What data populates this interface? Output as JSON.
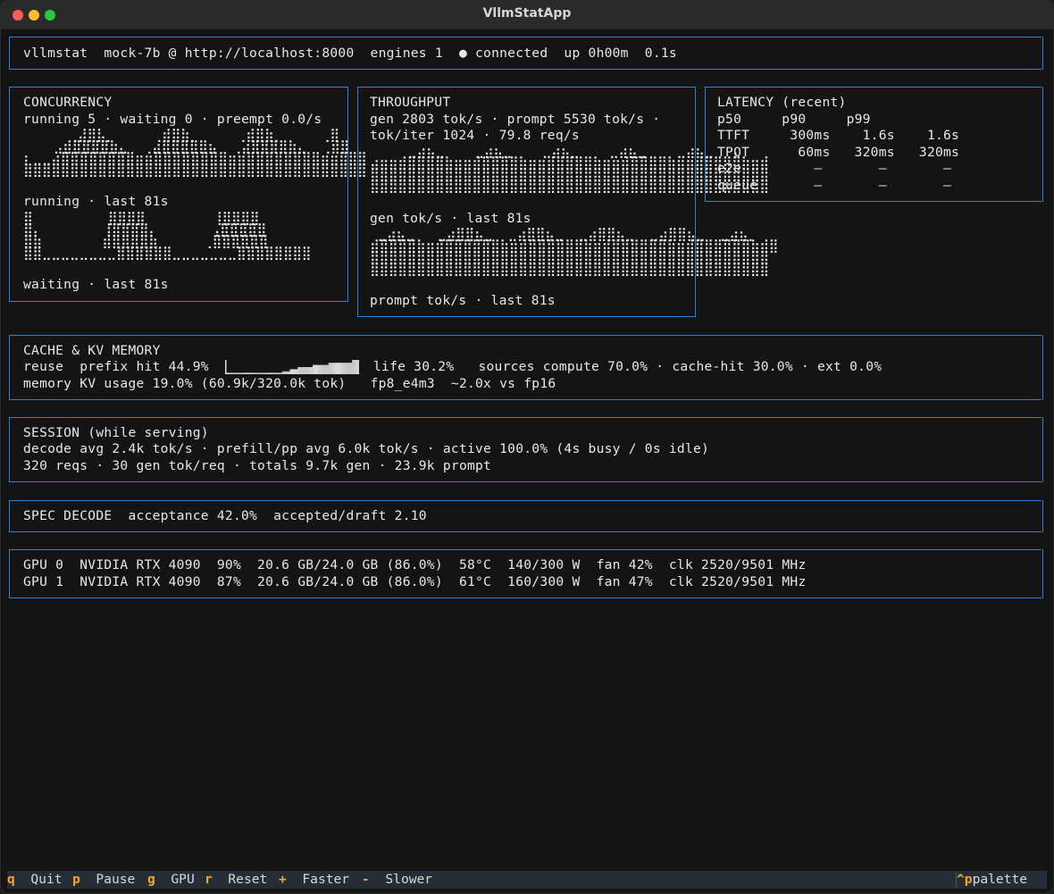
{
  "window": {
    "title": "VllmStatApp"
  },
  "header": {
    "line": "vllmstat  mock-7b @ http://localhost:8000  engines 1  ● connected  up 0h00m  0.1s"
  },
  "concurrency": {
    "title": "CONCURRENCY",
    "summary": "running 5 · waiting 0 · preempt 0.0/s",
    "running_label": "running · last 81s",
    "waiting_label": "waiting · last 81s",
    "running_graph": [
      "      ⢀⣼⣿⣧⡀     ⢀⣾⣿⣷⡀     ⢀⣾⣿⣷⡀     ⢀⣿",
      "    ⣠⣾⣿⣿⣿⣿⣷⣄  ⢀⣴⣿⣿⣿⣿⣿⣦  ⢀⣴⣿⣿⣿⣿⣷⣄  ⢀⣾⣿",
      "⡆⣀⣀⣴⣿⣿⣿⣿⣿⣿⣿⣿⣶⣶⣿⣿⣿⣿⣿⣿⣿⣿⣶⣶⣿⣿⣿⣿⣿⣿⣿⣿⣶⣶⣿⣿⣿",
      "⣿⣿⣿⣿⣿⣿⣿⣿⣿⣿⣿⣿⣿⣿⣿⣿⣿⣿⣿⣿⣿⣿⣿⣿⣿⣿⣿⣿⣿⣿⣿⣿⣿⣿⣿⣿⣿"
    ],
    "waiting_graph": [
      "⣿          ⣿⣿⣿⣿         ⢸⣿⣿⣿⣿",
      "⣿⡄        ⢸⣿⣿⣿⣿⡄       ⢠⣿⣿⣿⣿⣿",
      "⣿⣷        ⣾⣿⣿⣿⣿⣷      ⢀⣿⣿⣿⣿⣿⣿",
      "⣿⣿⣀⣀⣀⣀⣀⣀⣀⣀⣿⣿⣿⣿⣿⣿⣀⣀⣀⣀⣀⣀⣀⣿⣿⣿⣿⣿⣿⣿⣿"
    ]
  },
  "throughput": {
    "title": "THROUGHPUT",
    "summary1": "gen 2803 tok/s · prompt 5530 tok/s ·",
    "summary2": "tok/iter 1024 · 79.8 req/s",
    "gen_label": "gen tok/s · last 81s",
    "prompt_label": "prompt tok/s · last 81s",
    "gen_graph": [
      "     ⣀⣴⣦⣀    ⣀⣴⣦⣀    ⣀⣴⣦⣀    ⣀⣴⣦⣀    ⣀⣴⣦⣀  ⢠",
      "⣴⣶⣶⣾⣿⣿⣿⣿⣷⣶⣶⣾⣿⣿⣿⣿⣷⣶⣶⣾⣿⣿⣿⣿⣷⣶⣶⣾⣿⣿⣿⣿⣷⣶⣶⣾⣿⣿⣿⣿⣷⣶⣾",
      "⣿⣿⣿⣿⣿⣿⣿⣿⣿⣿⣿⣿⣿⣿⣿⣿⣿⣿⣿⣿⣿⣿⣿⣿⣿⣿⣿⣿⣿⣿⣿⣿⣿⣿⣿⣿⣿⣿⣿⣿⣿⣿⣿",
      "⣿⣿⣿⣿⣿⣿⣿⣿⣿⣿⣿⣿⣿⣿⣿⣿⣿⣿⣿⣿⣿⣿⣿⣿⣿⣿⣿⣿⣿⣿⣿⣿⣿⣿⣿⣿⣿⣿⣿⣿⣿⣿⣿"
    ],
    "prompt_graph": [
      " ⣀⣴⣦⣀   ⣀⣴⣿⣿⣦⣀  ⣀⣴⣿⣿⣦⣀  ⣀⣴⣿⣿⣦⣀  ⣀⣴⣿⣿⣦⣀  ⣀⣴⣦⡀",
      "⣾⣿⣿⣿⣿⣷⣶⣾⣿⣿⣿⣿⣿⣿⣷⣶⣾⣿⣿⣿⣿⣿⣿⣷⣶⣾⣿⣿⣿⣿⣿⣿⣷⣶⣾⣿⣿⣿⣿⣿⣿⣷⣾⣿",
      "⣿⣿⣿⣿⣿⣿⣿⣿⣿⣿⣿⣿⣿⣿⣿⣿⣿⣿⣿⣿⣿⣿⣿⣿⣿⣿⣿⣿⣿⣿⣿⣿⣿⣿⣿⣿⣿⣿⣿⣿⣿⣿⣿",
      "⣿⣿⣿⣿⣿⣿⣿⣿⣿⣿⣿⣿⣿⣿⣿⣿⣿⣿⣿⣿⣿⣿⣿⣿⣿⣿⣿⣿⣿⣿⣿⣿⣿⣿⣿⣿⣿⣿⣿⣿⣿⣿⣿"
    ]
  },
  "latency": {
    "title": "LATENCY (recent)",
    "header_line": "p50     p90     p99",
    "rows": [
      "TTFT     300ms    1.6s    1.6s",
      "TPOT      60ms   320ms   320ms",
      "e2e         –       –       –",
      "queue       –       –       –"
    ]
  },
  "cache": {
    "title": "CACHE & KV MEMORY",
    "reuse_label": "reuse  prefix hit 44.9%",
    "reuse_tail": "life 30.2%   sources compute 70.0% · cache-hit 30.0% · ext 0.0%",
    "memory_line": "memory KV usage 19.0% (60.9k/320.0k tok)   fp8_e4m3  ~2.0x vs fp16",
    "sparkline": [
      0.2,
      0.1,
      0.1,
      0.1,
      0.1,
      0.1,
      0.1,
      0.1,
      0.1,
      0.1,
      0.1,
      0.1,
      0.1,
      0.1,
      0.1,
      0.1,
      0.1,
      0.1,
      0.1,
      0.1,
      0.1,
      0.1,
      0.1,
      0.1,
      0.1,
      0.1,
      0.1,
      0.1,
      0.1,
      0.1,
      0.1,
      0.1,
      0.1,
      0.1,
      0.1,
      0.1,
      0.1,
      0.1,
      0.1,
      0.1,
      0.1,
      0.1,
      0.1,
      0.1,
      0.1,
      0.1,
      0.1,
      0.1,
      0.1,
      0.1,
      0.1,
      0.1,
      0.1,
      0.1,
      0.1,
      0.1,
      0.1,
      0.1,
      0.1,
      0.1,
      0.1,
      0.1,
      0.1,
      0.1,
      0.1,
      0.2,
      0.2,
      0.2,
      0.2,
      0.2,
      0.2,
      0.2,
      0.2,
      0.2,
      0.35,
      0.35,
      0.35,
      0.35,
      0.35,
      0.35,
      0.35,
      0.35,
      0.35,
      0.5,
      0.5,
      0.5,
      0.5,
      0.5,
      0.5,
      0.5,
      0.5,
      0.5,
      0.5,
      0.5,
      0.5,
      0.5,
      0.5,
      0.5,
      0.5,
      0.5,
      0.65,
      0.65,
      0.65,
      0.65,
      0.65,
      0.65,
      0.65,
      0.65,
      0.65,
      0.65,
      0.65,
      0.65,
      0.65,
      0.65,
      0.65,
      0.65,
      0.65,
      0.65,
      0.8,
      0.8,
      0.8,
      0.8,
      0.8,
      0.8,
      0.8,
      0.8,
      0.8,
      0.8,
      0.8,
      0.8,
      0.8,
      0.8,
      0.8,
      0.8,
      0.8,
      0.8,
      0.8,
      0.8,
      0.8,
      0.8,
      0.8,
      0.8,
      0.8,
      0.8,
      0.8,
      1.0,
      1.0,
      1.0,
      1.0,
      1.0,
      1.0,
      1.0,
      1.0
    ]
  },
  "session": {
    "title": "SESSION (while serving)",
    "line1": "decode avg 2.4k tok/s · prefill/pp avg 6.0k tok/s · active 100.0% (4s busy / 0s idle)",
    "line2": "320 reqs · 30 gen tok/req · totals 9.7k gen · 23.9k prompt"
  },
  "spec": {
    "line": "SPEC DECODE  acceptance 42.0%  accepted/draft 2.10"
  },
  "gpu": {
    "rows": [
      "GPU 0  NVIDIA RTX 4090  90%  20.6 GB/24.0 GB (86.0%)  58°C  140/300 W  fan 42%  clk 2520/9501 MHz",
      "GPU 1  NVIDIA RTX 4090  87%  20.6 GB/24.0 GB (86.0%)  61°C  160/300 W  fan 47%  clk 2520/9501 MHz"
    ]
  },
  "footer": {
    "bindings": [
      {
        "key": "q",
        "label": "Quit"
      },
      {
        "key": "p",
        "label": "Pause"
      },
      {
        "key": "g",
        "label": "GPU"
      },
      {
        "key": "r",
        "label": "Reset"
      },
      {
        "key": "+",
        "label": "Faster"
      },
      {
        "key": "-",
        "label": "Slower"
      }
    ],
    "palette_key": "^p",
    "palette_label": "palette"
  },
  "colors": {
    "border": "#2f7fd0",
    "key": "#f6a623",
    "text": "#e8e8e8",
    "background": "#141414"
  }
}
